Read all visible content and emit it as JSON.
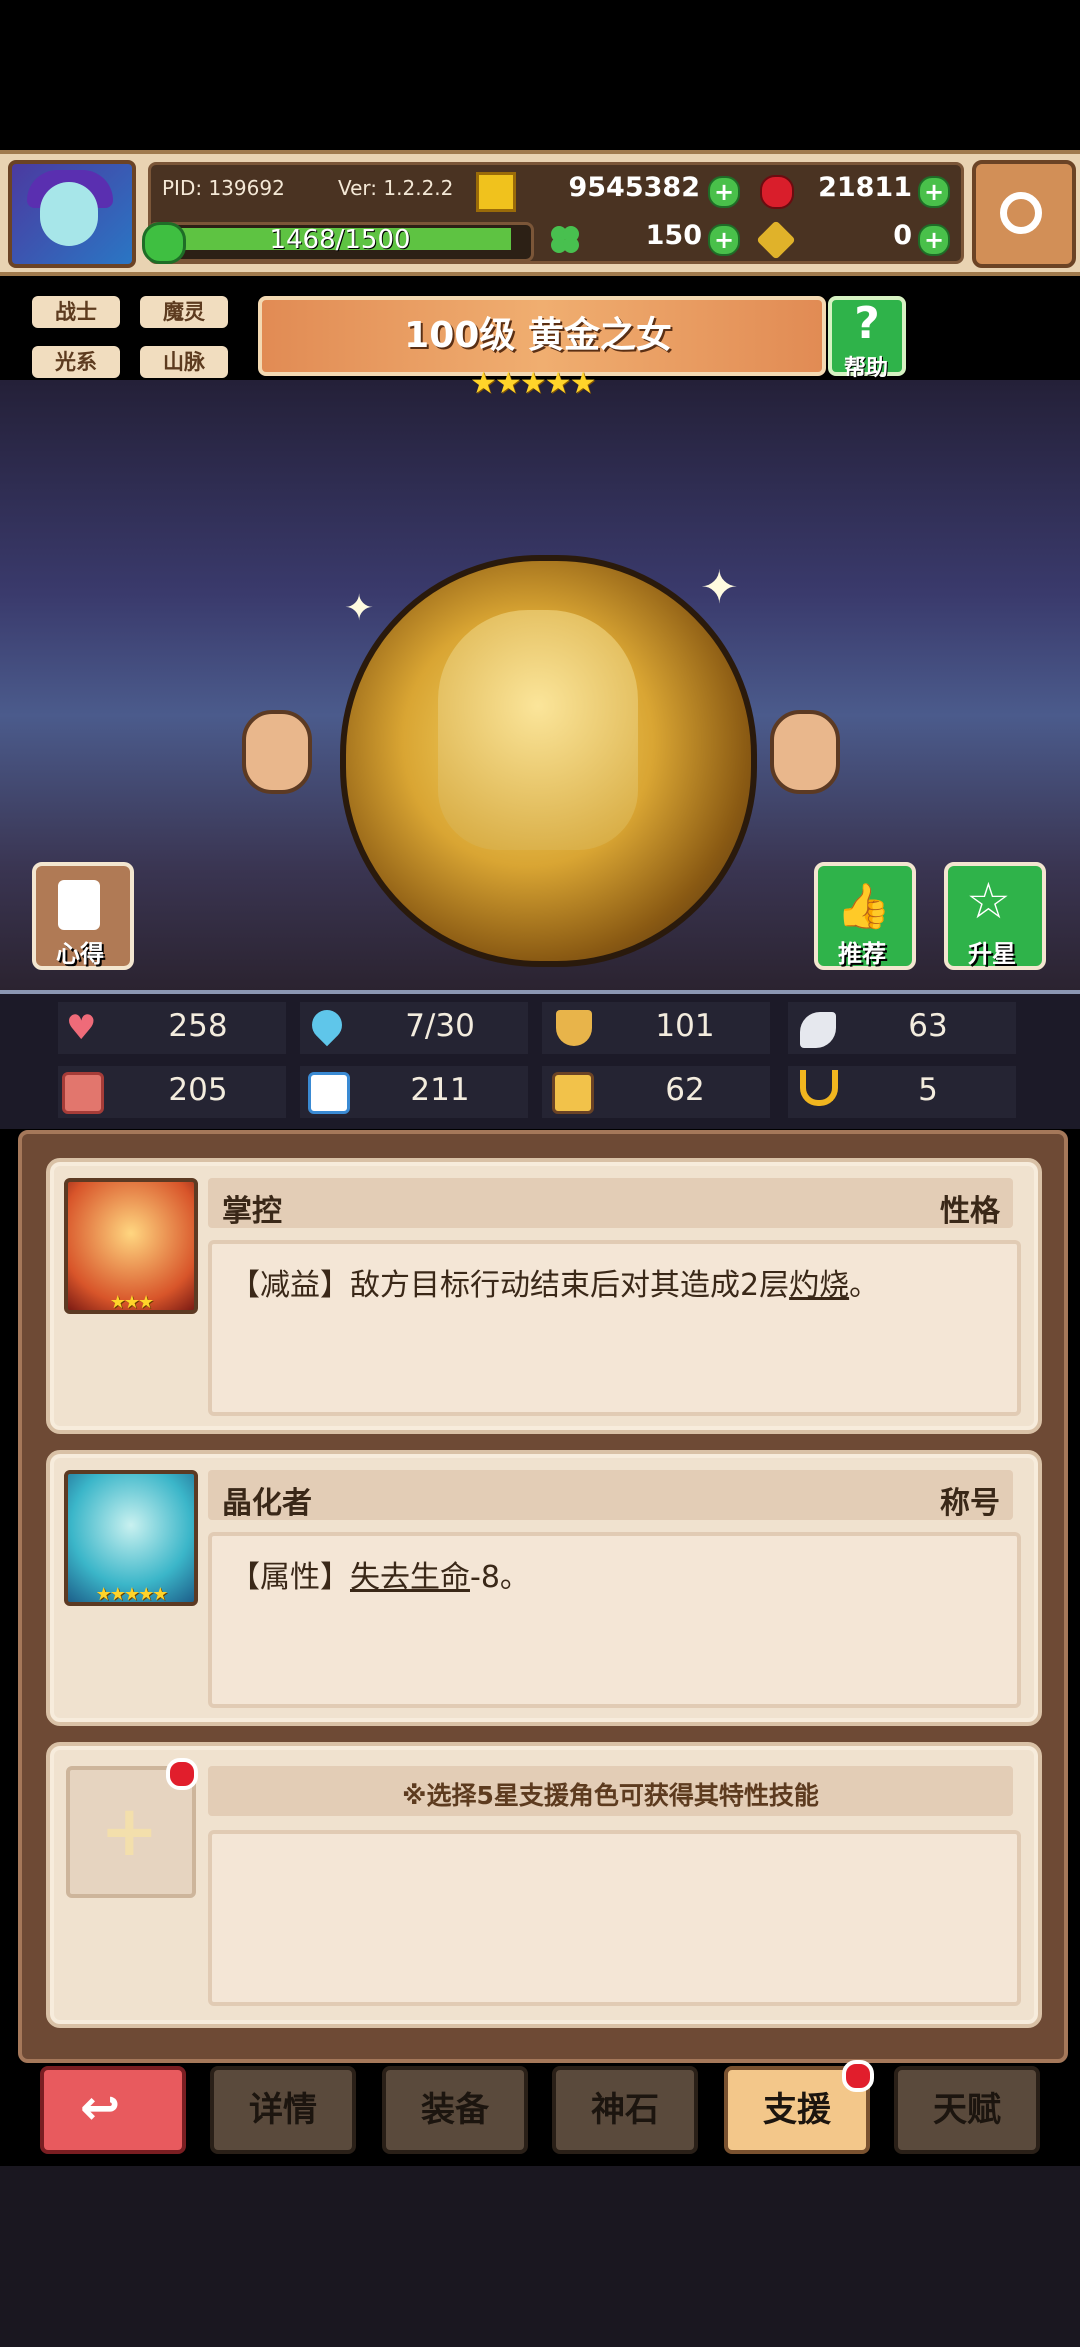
{
  "header": {
    "pid": "PID: 139692",
    "version": "Ver: 1.2.2.2",
    "gold": "9545382",
    "gems": "21811",
    "exp": "1468/1500",
    "exp_fraction": 0.979,
    "clover": "150",
    "keys": "0"
  },
  "tags": [
    "战士",
    "魔灵",
    "光系",
    "山脉"
  ],
  "hero": {
    "title": "100级  黄金之女",
    "stars": "★★★★★",
    "star_count": 5
  },
  "buttons": {
    "help": "帮助",
    "notes": "心得",
    "recommend": "推荐",
    "upgrade_star": "升星"
  },
  "stats": [
    {
      "icon": "heart-icon",
      "value": "258"
    },
    {
      "icon": "water-drop-icon",
      "value": "7/30"
    },
    {
      "icon": "shield-icon",
      "value": "101"
    },
    {
      "icon": "wing-icon",
      "value": "63"
    },
    {
      "icon": "fist-icon",
      "value": "205"
    },
    {
      "icon": "book-icon",
      "value": "211"
    },
    {
      "icon": "scroll-icon",
      "value": "62"
    },
    {
      "icon": "horseshoe-icon",
      "value": "5"
    }
  ],
  "support": [
    {
      "name": "掌控",
      "type": "性格",
      "text_prefix": "【减益】敌方目标行动结束后对其造成2层",
      "text_link": "灼烧",
      "text_suffix": "。",
      "stars": "★★★"
    },
    {
      "name": "晶化者",
      "type": "称号",
      "text_prefix": "【属性】",
      "text_link": "失去生命",
      "text_suffix": "-8。",
      "stars": "★★★★★"
    },
    {
      "hint": "※选择5星支援角色可获得其特性技能"
    }
  ],
  "tabs": [
    "详情",
    "装备",
    "神石",
    "支援",
    "天赋"
  ],
  "colors": {
    "accent_green": "#49c04a",
    "alert_red": "#e11e2c",
    "active_tab": "#f3c78a"
  }
}
